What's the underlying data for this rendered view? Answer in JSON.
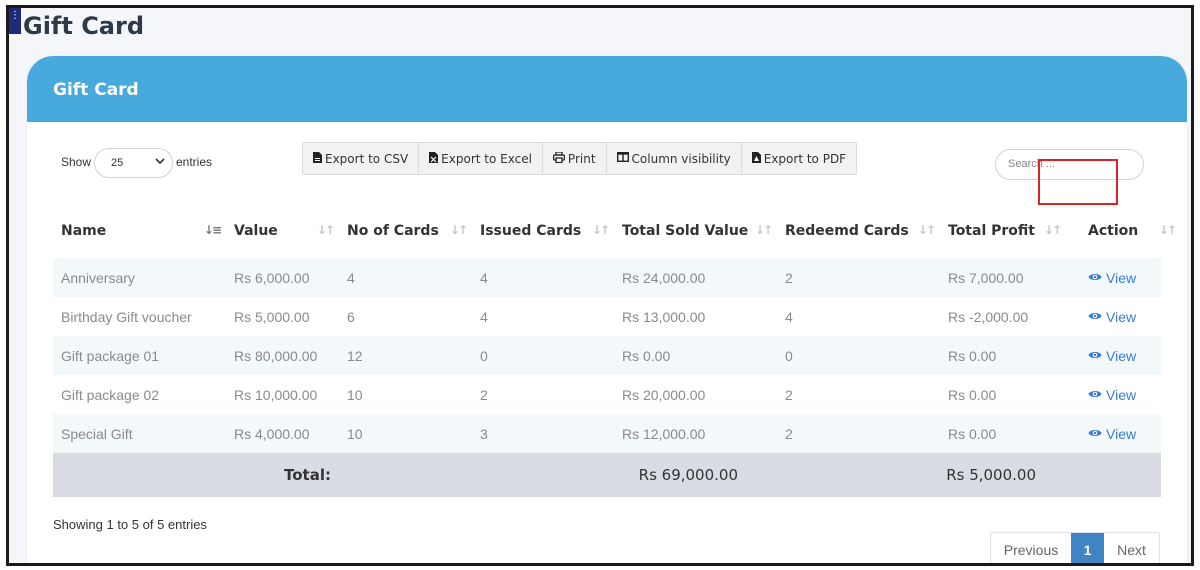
{
  "page": {
    "title": "Gift Card",
    "corner_glyph": "⋮"
  },
  "card": {
    "title": "Gift Card"
  },
  "length_menu": {
    "show_label": "Show",
    "selected": "25",
    "entries_label": "entries"
  },
  "export_buttons": [
    {
      "label": "Export to CSV",
      "icon": "file-csv-icon"
    },
    {
      "label": "Export to Excel",
      "icon": "file-excel-icon"
    },
    {
      "label": "Print",
      "icon": "print-icon"
    },
    {
      "label": "Column visibility",
      "icon": "columns-icon"
    },
    {
      "label": "Export to PDF",
      "icon": "file-pdf-icon"
    }
  ],
  "search": {
    "placeholder": "Search ..."
  },
  "table": {
    "columns": [
      "Name",
      "Value",
      "No of Cards",
      "Issued Cards",
      "Total Sold Value",
      "Redeemd Cards",
      "Total Profit",
      "Action"
    ],
    "rows": [
      {
        "name": "Anniversary",
        "value": "Rs 6,000.00",
        "cards": "4",
        "issued": "4",
        "sold": "Rs 24,000.00",
        "redeemed": "2",
        "profit": "Rs 7,000.00",
        "action": "View"
      },
      {
        "name": "Birthday Gift voucher",
        "value": "Rs 5,000.00",
        "cards": "6",
        "issued": "4",
        "sold": "Rs 13,000.00",
        "redeemed": "4",
        "profit": "Rs -2,000.00",
        "action": "View"
      },
      {
        "name": "Gift package 01",
        "value": "Rs 80,000.00",
        "cards": "12",
        "issued": "0",
        "sold": "Rs 0.00",
        "redeemed": "0",
        "profit": "Rs 0.00",
        "action": "View"
      },
      {
        "name": "Gift package 02",
        "value": "Rs 10,000.00",
        "cards": "10",
        "issued": "2",
        "sold": "Rs 20,000.00",
        "redeemed": "2",
        "profit": "Rs 0.00",
        "action": "View"
      },
      {
        "name": "Special Gift",
        "value": "Rs 4,000.00",
        "cards": "10",
        "issued": "3",
        "sold": "Rs 12,000.00",
        "redeemed": "2",
        "profit": "Rs 0.00",
        "action": "View"
      }
    ],
    "footer": {
      "label": "Total:",
      "sold_total": "Rs 69,000.00",
      "profit_total": "Rs 5,000.00"
    }
  },
  "info_text": "Showing 1 to 5 of 5 entries",
  "pagination": {
    "previous": "Previous",
    "current": "1",
    "next": "Next"
  },
  "colors": {
    "header": "#47a9dc",
    "highlight": "#d9242b",
    "link": "#3a7bd5",
    "active_page": "#3f84c3"
  }
}
